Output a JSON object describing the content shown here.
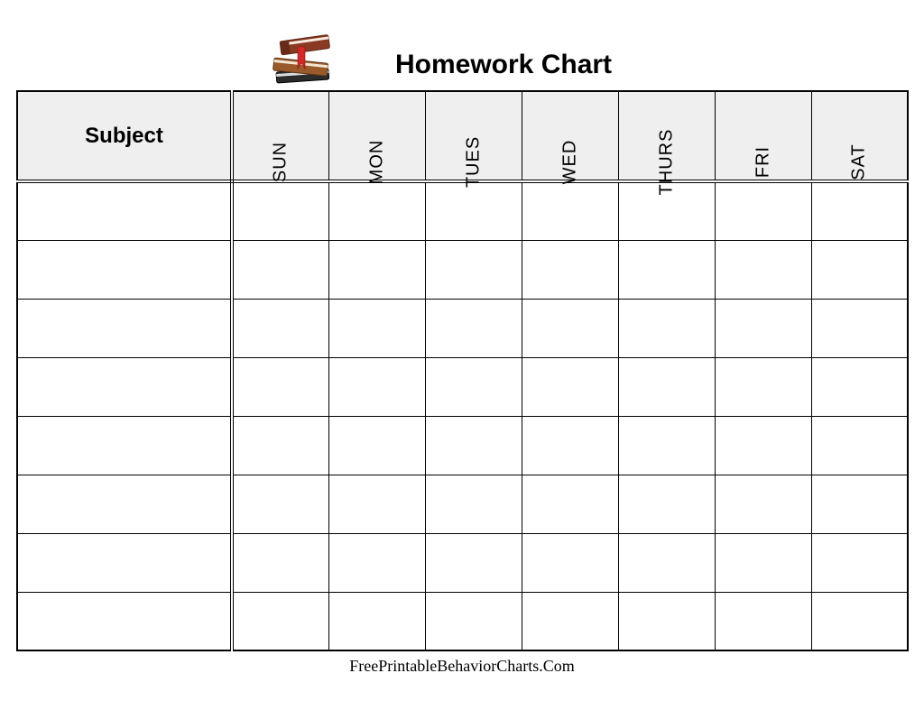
{
  "title": "Homework Chart",
  "icon": "books-stack-icon",
  "columns": {
    "subject": "Subject",
    "days": [
      "SUN",
      "MON",
      "TUES",
      "WED",
      "THURS",
      "FRI",
      "SAT"
    ]
  },
  "rows": [
    {
      "subject": "",
      "cells": [
        "",
        "",
        "",
        "",
        "",
        "",
        ""
      ]
    },
    {
      "subject": "",
      "cells": [
        "",
        "",
        "",
        "",
        "",
        "",
        ""
      ]
    },
    {
      "subject": "",
      "cells": [
        "",
        "",
        "",
        "",
        "",
        "",
        ""
      ]
    },
    {
      "subject": "",
      "cells": [
        "",
        "",
        "",
        "",
        "",
        "",
        ""
      ]
    },
    {
      "subject": "",
      "cells": [
        "",
        "",
        "",
        "",
        "",
        "",
        ""
      ]
    },
    {
      "subject": "",
      "cells": [
        "",
        "",
        "",
        "",
        "",
        "",
        ""
      ]
    },
    {
      "subject": "",
      "cells": [
        "",
        "",
        "",
        "",
        "",
        "",
        ""
      ]
    },
    {
      "subject": "",
      "cells": [
        "",
        "",
        "",
        "",
        "",
        "",
        ""
      ]
    }
  ],
  "footer": "FreePrintableBehaviorCharts.Com"
}
